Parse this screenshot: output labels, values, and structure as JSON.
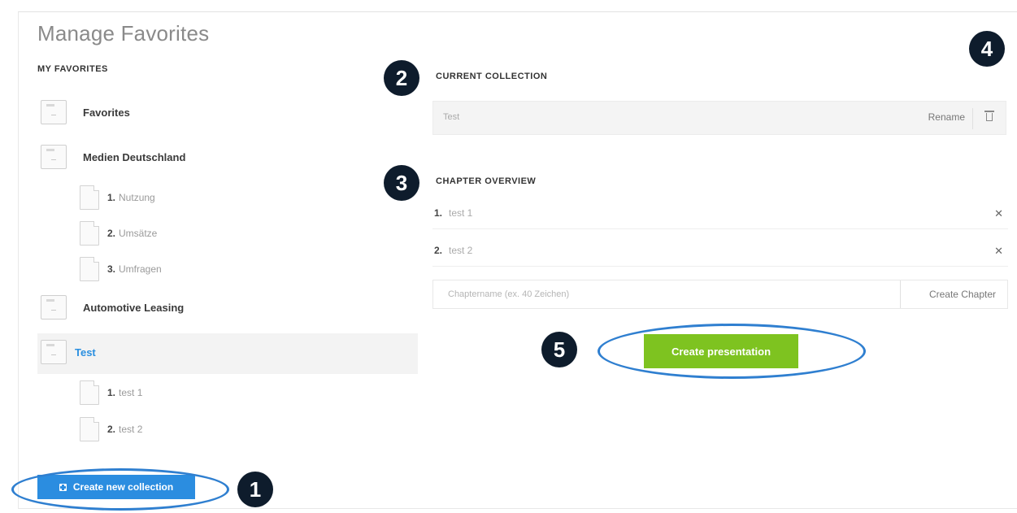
{
  "header": {
    "title": "Manage Favorites"
  },
  "left": {
    "section_title": "MY FAVORITES",
    "tree": [
      {
        "label": "Favorites"
      },
      {
        "label": "Medien Deutschland",
        "children": [
          {
            "num": "1.",
            "label": "Nutzung"
          },
          {
            "num": "2.",
            "label": "Umsätze"
          },
          {
            "num": "3.",
            "label": "Umfragen"
          }
        ]
      },
      {
        "label": "Automotive Leasing"
      },
      {
        "label": "Test",
        "children": [
          {
            "num": "1.",
            "label": "test 1"
          },
          {
            "num": "2.",
            "label": "test 2"
          }
        ]
      }
    ],
    "create_collection_label": "Create new collection"
  },
  "right": {
    "current_collection": {
      "section_title": "CURRENT COLLECTION",
      "value": "Test",
      "rename_label": "Rename"
    },
    "chapter_overview": {
      "section_title": "CHAPTER OVERVIEW",
      "chapters": [
        {
          "num": "1.",
          "name": "test 1"
        },
        {
          "num": "2.",
          "name": "test 2"
        }
      ],
      "input_placeholder": "Chaptername (ex. 40 Zeichen)",
      "create_chapter_label": "Create Chapter"
    },
    "create_presentation_label": "Create presentation"
  },
  "markers": [
    "1",
    "2",
    "3",
    "4",
    "5"
  ],
  "icons": {
    "folder": "folder-icon",
    "document": "document-icon",
    "trash": "trash-icon",
    "remove": "close-icon",
    "plus": "plus-icon"
  },
  "colors": {
    "primary_blue": "#2b8de0",
    "accent_green": "#7ec320",
    "marker_dark": "#0e1c2c",
    "highlight_ellipse": "#2f7fd0"
  }
}
